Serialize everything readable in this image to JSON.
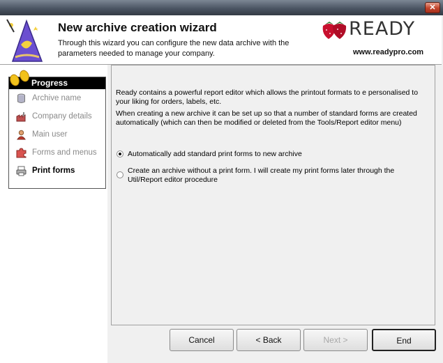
{
  "window": {
    "close_symbol": "✕"
  },
  "header": {
    "title": "New archive creation wizard",
    "subtitle": "Through this wizard you can configure the new data archive with the parameters needed to manage your company.",
    "logo_text": "READY",
    "website": "www.readypro.com",
    "wizard_icon": "wizard-hat-icon",
    "logo_icon": "strawberry-icon"
  },
  "progress": {
    "heading": "Progress",
    "steps": [
      {
        "label": "Archive name",
        "icon": "database-icon",
        "active": false
      },
      {
        "label": "Company details",
        "icon": "factory-icon",
        "active": false
      },
      {
        "label": "Main user",
        "icon": "user-icon",
        "active": false
      },
      {
        "label": "Forms and menus",
        "icon": "puzzle-icon",
        "active": false
      },
      {
        "label": "Print forms",
        "icon": "printer-icon",
        "active": true
      }
    ]
  },
  "content": {
    "paragraph1": "Ready contains a powerful report editor which allows the printout formats to e personalised to your liking for orders, labels, etc.",
    "paragraph2": "When creating a new archive it can be set up so that a number of standard forms are created automatically (which can then be modified or deleted from the Tools/Report editor menu)",
    "options": [
      {
        "label": "Automatically add standard print forms to new archive",
        "checked": true
      },
      {
        "label": "Create an archive without a print form. I will create my print forms later through the Util/Report editor procedure",
        "checked": false
      }
    ]
  },
  "buttons": {
    "cancel": "Cancel",
    "back": "< Back",
    "next": "Next >",
    "end": "End"
  },
  "colors": {
    "accent_red": "#c8102e",
    "progress_bg": "#000000",
    "panel_bg": "#f0f0f0"
  }
}
